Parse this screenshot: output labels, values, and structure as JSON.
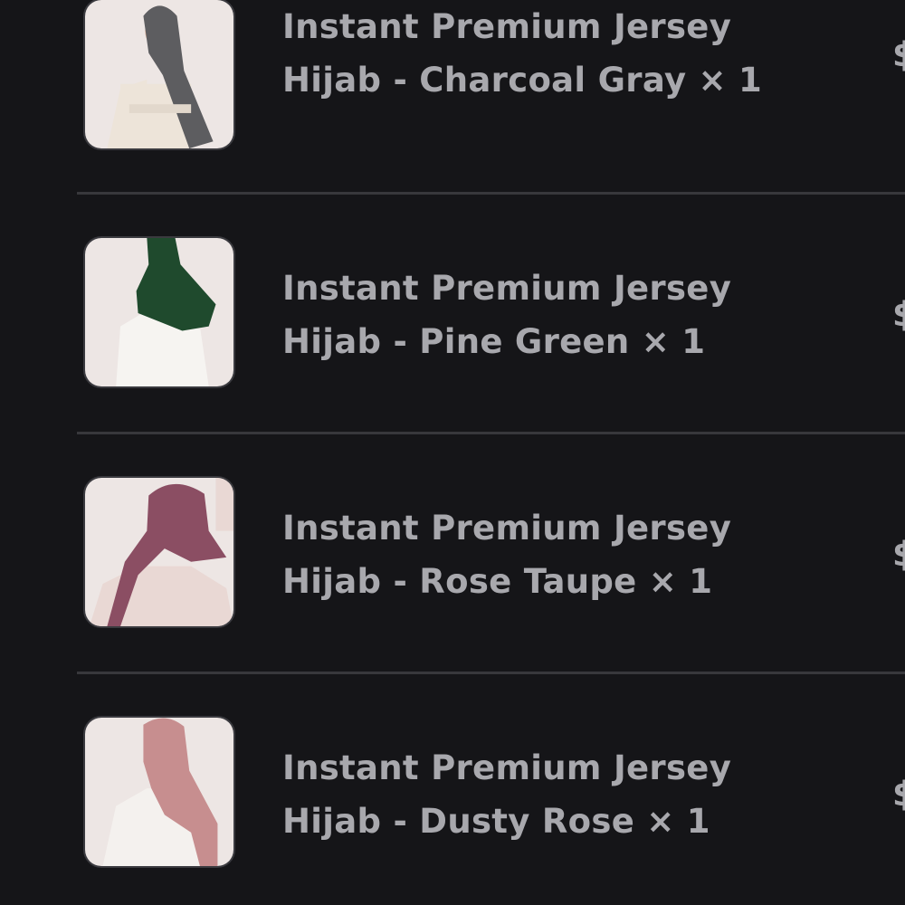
{
  "order_items": [
    {
      "line1": "Instant Premium Jersey",
      "line2": "Hijab - Charcoal Gray × 1",
      "price_prefix": "$",
      "image_alt": "model wearing charcoal gray hijab",
      "scarf_color": "#5d5d60",
      "garment_color": "#ede4d9"
    },
    {
      "line1": "Instant Premium Jersey",
      "line2": "Hijab - Pine Green × 1",
      "price_prefix": "$",
      "image_alt": "model wearing pine green hijab",
      "scarf_color": "#1f4a2d",
      "garment_color": "#f6f4f1"
    },
    {
      "line1": "Instant Premium Jersey",
      "line2": "Hijab - Rose Taupe × 1",
      "price_prefix": "$",
      "image_alt": "model wearing rose taupe hijab",
      "scarf_color": "#8b4e63",
      "garment_color": "#e9d8d4"
    },
    {
      "line1": "Instant Premium Jersey",
      "line2": "Hijab - Dusty Rose × 1",
      "price_prefix": "$",
      "image_alt": "model wearing dusty rose hijab",
      "scarf_color": "#c78e8f",
      "garment_color": "#f4f1ee"
    }
  ],
  "colors": {
    "background": "#151518",
    "text": "#a8a8ad",
    "divider": "#38383c",
    "image_background": "#ede6e4"
  }
}
